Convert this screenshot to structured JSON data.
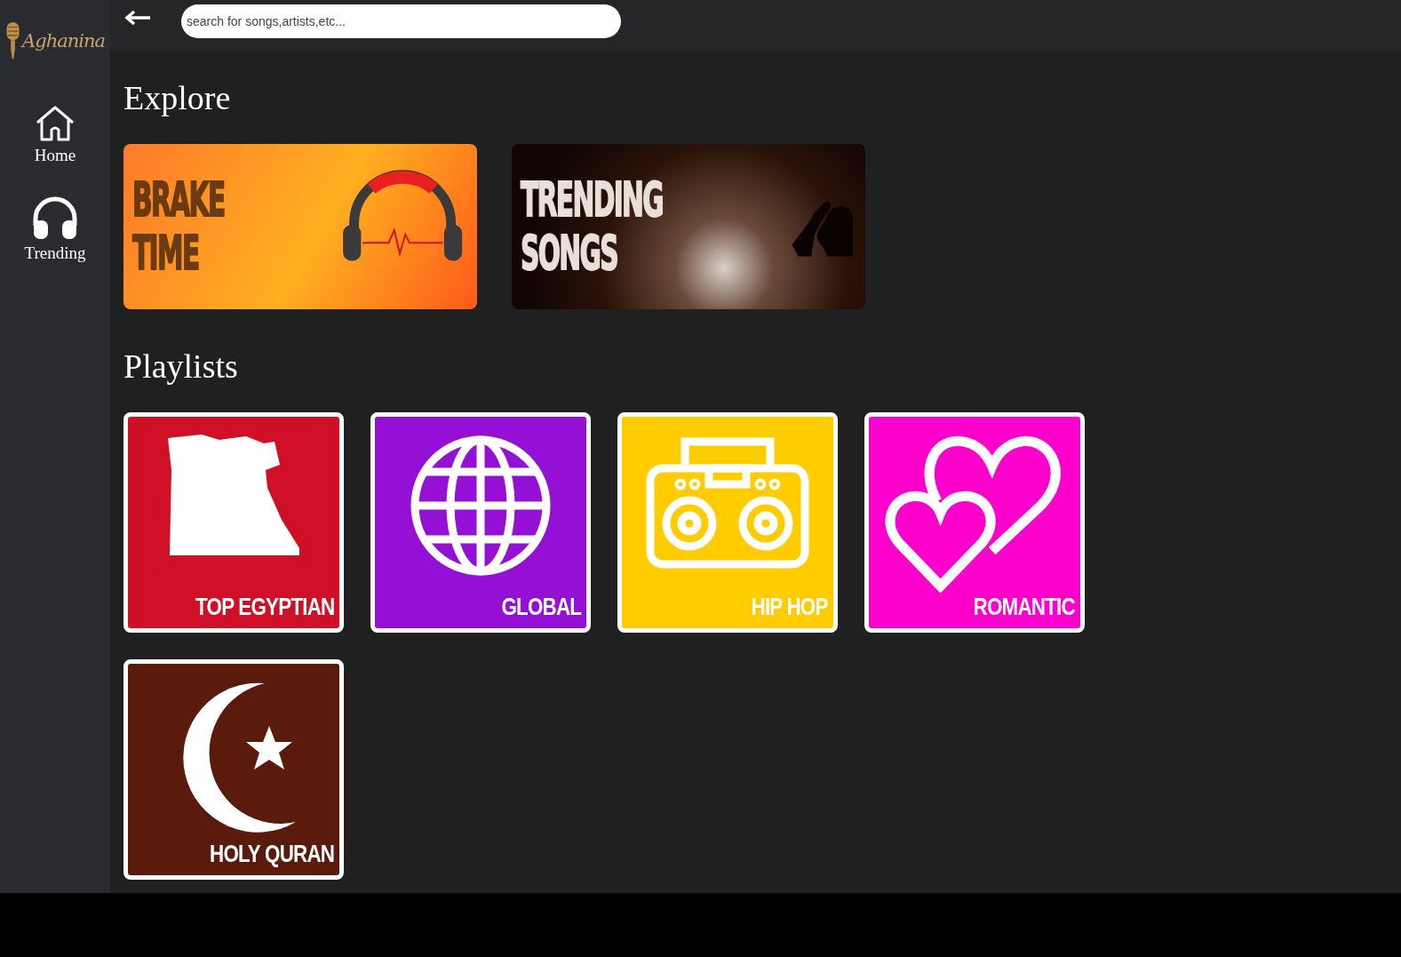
{
  "logo": {
    "text": "Aghanina"
  },
  "sidebar": {
    "items": [
      {
        "label": "Home",
        "kind": "home"
      },
      {
        "label": "Trending",
        "kind": "headphones"
      }
    ]
  },
  "search": {
    "placeholder": "search for songs,artists,etc..."
  },
  "explore": {
    "title": "Explore",
    "cards": [
      {
        "kind": "break",
        "title": "BRAKE TIME"
      },
      {
        "kind": "trending",
        "title": "TRENDING SONGS"
      }
    ]
  },
  "playlists": {
    "title": "Playlists",
    "items": [
      {
        "kind": "egypt",
        "color": "#d01026",
        "title": "TOP EGYPTIAN"
      },
      {
        "kind": "globe",
        "color": "#9410d4",
        "title": "GLOBAL"
      },
      {
        "kind": "boombox",
        "color": "#ffcc00",
        "title": "HIP HOP"
      },
      {
        "kind": "hearts",
        "color": "#ff00cc",
        "title": "ROMANTIC"
      },
      {
        "kind": "crescent",
        "color": "#5a1a0c",
        "title": "HOLY QURAN"
      }
    ]
  }
}
